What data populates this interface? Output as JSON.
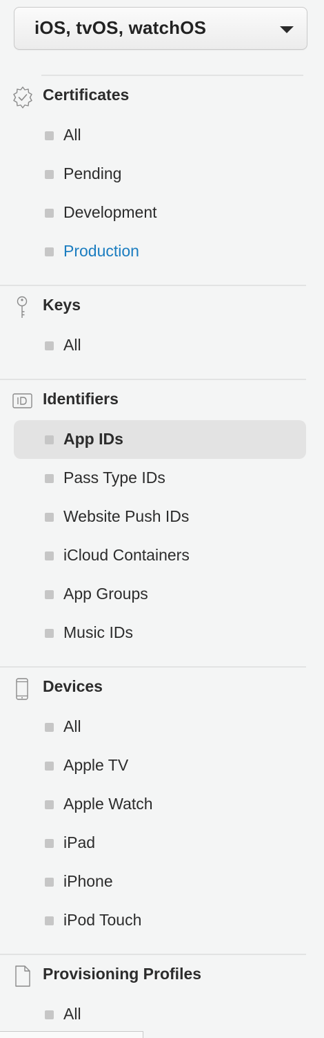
{
  "platform_select": {
    "label": "iOS, tvOS, watchOS"
  },
  "sections": {
    "certificates": {
      "title": "Certificates",
      "icon": "certificate-badge-icon",
      "items": [
        "All",
        "Pending",
        "Development",
        "Production"
      ]
    },
    "keys": {
      "title": "Keys",
      "icon": "key-icon",
      "items": [
        "All"
      ]
    },
    "identifiers": {
      "title": "Identifiers",
      "icon": "id-icon",
      "items": [
        "App IDs",
        "Pass Type IDs",
        "Website Push IDs",
        "iCloud Containers",
        "App Groups",
        "Music IDs"
      ]
    },
    "devices": {
      "title": "Devices",
      "icon": "device-icon",
      "items": [
        "All",
        "Apple TV",
        "Apple Watch",
        "iPad",
        "iPhone",
        "iPod Touch"
      ]
    },
    "profiles": {
      "title": "Provisioning Profiles",
      "icon": "document-icon",
      "items": [
        "All"
      ]
    }
  },
  "state": {
    "selected_item": "App IDs",
    "highlighted_link": "Production"
  },
  "colors": {
    "background": "#f4f5f5",
    "link_blue": "#1b7dc0",
    "selected_background": "#e3e3e3",
    "bullet_gray": "#c6c6c6"
  }
}
